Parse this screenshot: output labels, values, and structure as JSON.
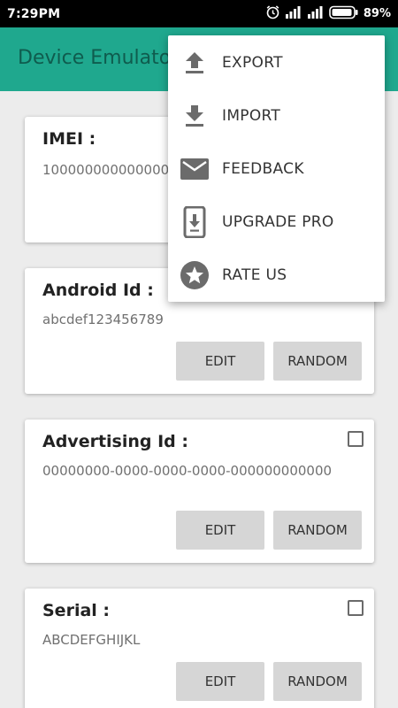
{
  "status_bar": {
    "time": "7:29PM",
    "battery": "89%",
    "icons": [
      "alarm-icon",
      "signal-icon",
      "signal-icon",
      "battery-icon"
    ]
  },
  "app_bar": {
    "title": "Device Emulator"
  },
  "cards": [
    {
      "title": "IMEI :",
      "value": "1000000000000000"
    },
    {
      "title": "Android Id :",
      "value": "abcdef123456789",
      "edit_label": "EDIT",
      "random_label": "RANDOM"
    },
    {
      "title": "Advertising Id :",
      "value": "00000000-0000-0000-0000-000000000000",
      "edit_label": "EDIT",
      "random_label": "RANDOM"
    },
    {
      "title": "Serial :",
      "value": "ABCDEFGHIJKL",
      "edit_label": "EDIT",
      "random_label": "RANDOM"
    }
  ],
  "menu": {
    "items": [
      {
        "label": "EXPORT",
        "icon": "upload-icon"
      },
      {
        "label": "IMPORT",
        "icon": "download-icon"
      },
      {
        "label": "FEEDBACK",
        "icon": "mail-icon"
      },
      {
        "label": "UPGRADE PRO",
        "icon": "phone-download-icon"
      },
      {
        "label": "RATE US",
        "icon": "star-icon"
      }
    ]
  },
  "colors": {
    "primary": "#1fa88e",
    "title_dim": "#0f5c4e",
    "button_bg": "#d6d6d6",
    "icon_gray": "#6b6b6b"
  }
}
